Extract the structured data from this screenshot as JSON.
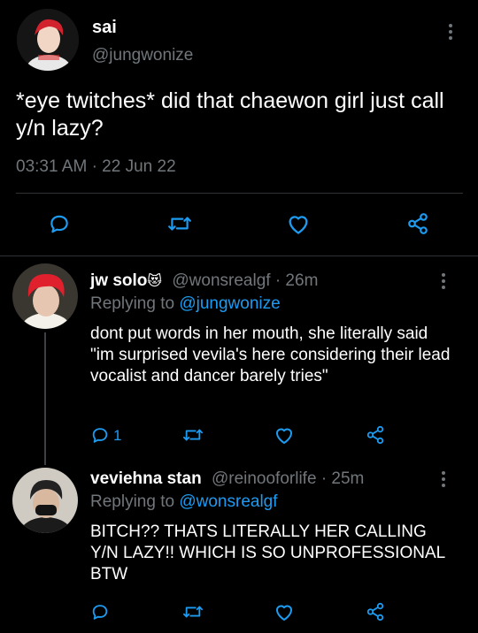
{
  "main_tweet": {
    "display_name": "sai",
    "handle": "@jungwonize",
    "text": "*eye twitches* did that chaewon girl just call y/n lazy?",
    "time": "03:31 AM",
    "separator": "·",
    "date": "22 Jun 22"
  },
  "replies": [
    {
      "display_name": "jw solo",
      "emoji": "😻",
      "handle": "@wonsrealgf",
      "age": "· 26m",
      "replying_label": "Replying to",
      "replying_to": "@jungwonize",
      "text": "dont put words in her mouth, she literally said \"im surprised vevila's here considering their lead vocalist and dancer barely tries\"",
      "reply_count": "1"
    },
    {
      "display_name": "veviehna stan",
      "handle": "@reinooforlife",
      "age": "· 25m",
      "replying_label": "Replying to",
      "replying_to": "@wonsrealgf",
      "text": "BITCH?? THATS LITERALLY HER CALLING Y/N LAZY!! WHICH IS SO UNPROFESSIONAL BTW"
    }
  ],
  "colors": {
    "background": "#000000",
    "text": "#ffffff",
    "muted": "#71767b",
    "accent": "#1d9bf0",
    "divider": "#2f3336"
  }
}
